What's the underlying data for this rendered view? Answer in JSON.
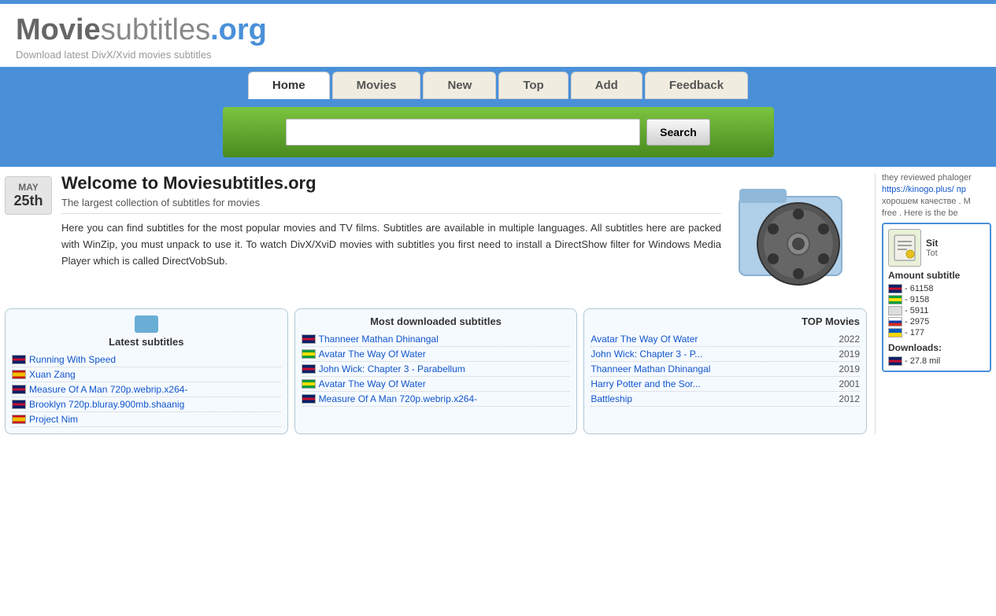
{
  "header": {
    "title_movie": "Movie",
    "title_subtitles": "subtitles",
    "title_org": ".org",
    "tagline": "Download latest DivX/Xvid movies subtitles"
  },
  "nav": {
    "tabs": [
      {
        "label": "Home",
        "active": true
      },
      {
        "label": "Movies",
        "active": false
      },
      {
        "label": "New",
        "active": false
      },
      {
        "label": "Top",
        "active": false
      },
      {
        "label": "Add",
        "active": false
      },
      {
        "label": "Feedback",
        "active": false
      }
    ]
  },
  "search": {
    "placeholder": "",
    "button_label": "Search"
  },
  "welcome": {
    "date_month": "MAY",
    "date_day": "25th",
    "heading": "Welcome to Moviesubtitles.org",
    "subtitle": "The largest collection of subtitles for movies",
    "body": "Here you can find subtitles for the most popular movies and TV films. Subtitles are available in multiple languages. All subtitles here are packed with WinZip, you must unpack to use it. To watch DivX/XviD movies with subtitles you first need to install a DirectShow filter for Windows Media Player which is called DirectVobSub."
  },
  "latest_subtitles": {
    "title": "Latest subtitles",
    "items": [
      {
        "flag": "uk",
        "title": "Running With Speed"
      },
      {
        "flag": "es",
        "title": "Xuan Zang"
      },
      {
        "flag": "uk",
        "title": "Measure Of A Man 720p.webrip.x264-"
      },
      {
        "flag": "uk",
        "title": "Brooklyn 720p.bluray.900mb.shaanig"
      },
      {
        "flag": "es",
        "title": "Project Nim"
      }
    ]
  },
  "most_downloaded": {
    "title": "Most downloaded subtitles",
    "items": [
      {
        "flag": "uk",
        "title": "Thanneer Mathan Dhinangal"
      },
      {
        "flag": "br",
        "title": "Avatar The Way Of Water"
      },
      {
        "flag": "uk",
        "title": "John Wick: Chapter 3 - Parabellum"
      },
      {
        "flag": "br",
        "title": "Avatar The Way Of Water"
      },
      {
        "flag": "uk",
        "title": "Measure Of A Man 720p.webrip.x264-"
      }
    ]
  },
  "top_movies": {
    "title": "TOP Movies",
    "items": [
      {
        "title": "Avatar The Way Of Water",
        "year": "2022"
      },
      {
        "title": "John Wick: Chapter 3 - P...",
        "year": "2019"
      },
      {
        "title": "Thanneer Mathan Dhinangal",
        "year": "2019"
      },
      {
        "title": "Harry Potter and the Sor...",
        "year": "2001"
      },
      {
        "title": "Battleship",
        "year": "2012"
      }
    ]
  },
  "sidebar": {
    "comments": [
      {
        "text": "they reviewed phaloger"
      },
      {
        "text": "https://kinogo.plus/ пр"
      },
      {
        "text": "хорошем качестве . M"
      },
      {
        "text": "free . Here is the be"
      }
    ],
    "stats_heading": "Sit",
    "stats_sub": "Tot",
    "amount_label": "Amount subtitle",
    "flags_stats": [
      {
        "flag": "uk",
        "count": "- 61158"
      },
      {
        "flag": "br",
        "count": "- 9158"
      },
      {
        "flag": "none",
        "count": "- 5911"
      },
      {
        "flag": "ru",
        "count": "- 2975"
      },
      {
        "flag": "ua",
        "count": "- 177"
      }
    ],
    "downloads_label": "Downloads:",
    "download_stats": [
      {
        "flag": "uk",
        "count": "- 27.8 mil"
      }
    ]
  }
}
